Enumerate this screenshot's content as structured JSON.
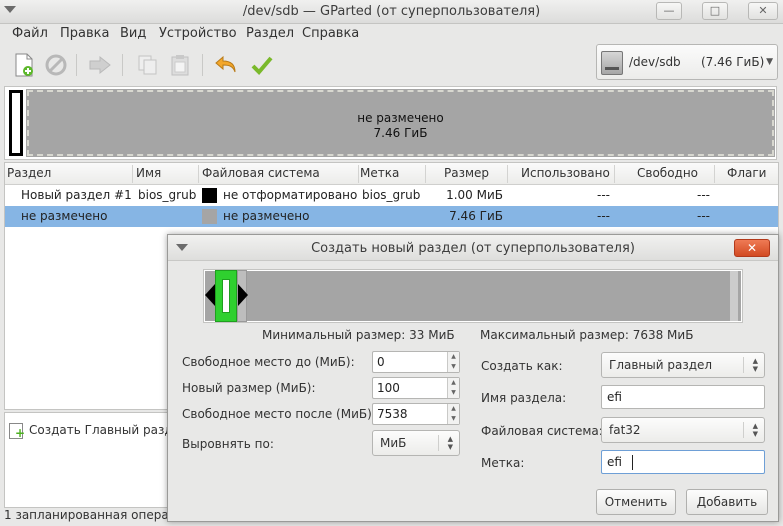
{
  "window": {
    "title": "/dev/sdb — GParted (от суперпользователя)",
    "btn_min": "—",
    "btn_max": "□",
    "btn_close": "✕"
  },
  "menu": [
    "Файл",
    "Правка",
    "Вид",
    "Устройство",
    "Раздел",
    "Справка"
  ],
  "device": {
    "name": "/dev/sdb",
    "size": "(7.46 ГиБ)"
  },
  "disk_graph": {
    "label": "не размечено",
    "size": "7.46 ГиБ"
  },
  "columns": [
    "Раздел",
    "Имя",
    "Файловая система",
    "Метка",
    "Размер",
    "Использовано",
    "Свободно",
    "Флаги"
  ],
  "rows": [
    {
      "partition": "Новый раздел #1",
      "name": "bios_grub",
      "fs": "не отформатировано",
      "fs_color": "#000000",
      "label": "bios_grub",
      "size": "1.00 МиБ",
      "used": "---",
      "free": "---",
      "flags": ""
    },
    {
      "partition": "не размечено",
      "name": "",
      "fs": "не размечено",
      "fs_color": "#a5a5a5",
      "label": "",
      "size": "7.46 ГиБ",
      "used": "---",
      "free": "---",
      "flags": ""
    }
  ],
  "pending": {
    "op": "Создать Главный разде",
    "status": "1 запланированная опера"
  },
  "dialog": {
    "title": "Создать новый раздел (от суперпользователя)",
    "close": "✕",
    "min_size": "Минимальный размер: 33 МиБ",
    "max_size": "Максимальный размер: 7638 МиБ",
    "free_before_label": "Свободное место до (МиБ):",
    "free_before": "0",
    "new_size_label": "Новый размер (МиБ):",
    "new_size": "100",
    "free_after_label": "Свободное место после (МиБ):",
    "free_after": "7538",
    "align_label": "Выровнять по:",
    "align": "МиБ",
    "create_as_label": "Создать как:",
    "create_as": "Главный раздел",
    "part_name_label": "Имя раздела:",
    "part_name": "efi",
    "fs_label": "Файловая система:",
    "fs": "fat32",
    "label_label": "Метка:",
    "label": "efi",
    "cancel": "Отменить",
    "add": "Добавить"
  }
}
